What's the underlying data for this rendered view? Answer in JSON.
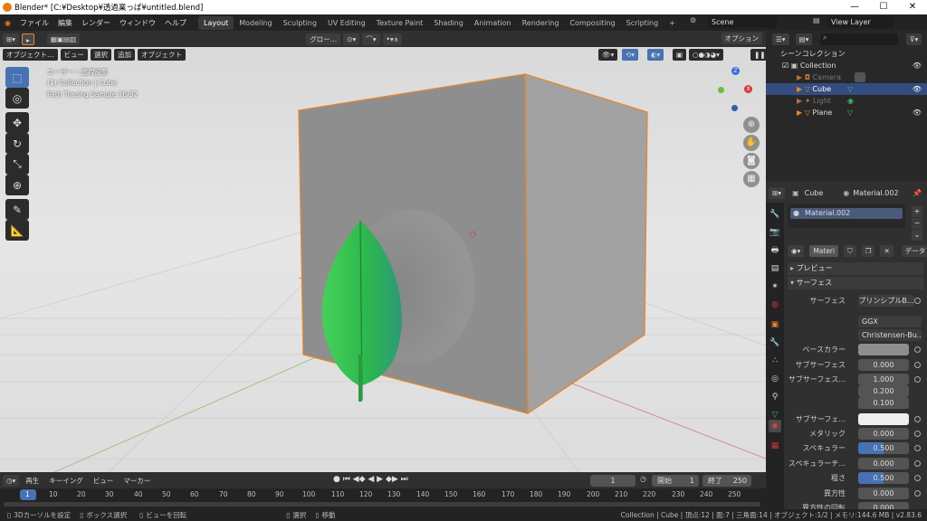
{
  "window": {
    "title": "Blender* [C:¥Desktop¥透過業っぱ¥untitled.blend]",
    "controls": [
      "—",
      "☐",
      "✕"
    ]
  },
  "menu": {
    "items": [
      "ファイル",
      "編集",
      "レンダー",
      "ウィンドウ",
      "ヘルプ"
    ],
    "workspaces": [
      "Layout",
      "Modeling",
      "Sculpting",
      "UV Editing",
      "Texture Paint",
      "Shading",
      "Animation",
      "Rendering",
      "Compositing",
      "Scripting"
    ],
    "add_tab": "+",
    "scene": "Scene",
    "view_layer": "View Layer"
  },
  "viewport_header": {
    "transform": "グロー…",
    "options": "オプション"
  },
  "viewport_subheader": {
    "mode": "オブジェクト…",
    "items": [
      "ビュー",
      "選択",
      "追加",
      "オブジェクト"
    ]
  },
  "viewport_overlay": {
    "view_name": "ユーザー・透視投影",
    "collection": "(1) Collection | Cube",
    "render_info": "Path Tracing Sample 16/32"
  },
  "outliner": {
    "search_placeholder": "",
    "root": "シーンコレクション",
    "collection": "Collection",
    "objects": [
      "Camera",
      "Cube",
      "Light",
      "Plane"
    ]
  },
  "properties": {
    "object": "Cube",
    "material": "Material.002",
    "slot": "Material.002",
    "mat_field": "Materi",
    "data_label": "データ",
    "sections": {
      "preview": "プレビュー",
      "surface": "サーフェス"
    },
    "rows": [
      {
        "label": "サーフェス",
        "value": "プリンシプルB..."
      },
      {
        "label": "",
        "value": "GGX"
      },
      {
        "label": "",
        "value": "Christensen-Bu..."
      },
      {
        "label": "ベースカラー",
        "value": ""
      },
      {
        "label": "サブサーフェス",
        "value": "0.000"
      },
      {
        "label": "サブサーフェス...",
        "value": "1.000"
      },
      {
        "label": "",
        "value": "0.200"
      },
      {
        "label": "",
        "value": "0.100"
      },
      {
        "label": "サブサーフェ...",
        "value": ""
      },
      {
        "label": "メタリック",
        "value": "0.000"
      },
      {
        "label": "スペキュラー",
        "value": "0.500"
      },
      {
        "label": "スペキュラーチ...",
        "value": "0.000"
      },
      {
        "label": "粗さ",
        "value": "0.500"
      },
      {
        "label": "異方性",
        "value": "0.000"
      },
      {
        "label": "異方性の回転",
        "value": "0.000"
      }
    ]
  },
  "timeline": {
    "menus": [
      "再生",
      "キーイング",
      "ビュー",
      "マーカー"
    ],
    "current_frame": "1",
    "start_label": "開始",
    "start": "1",
    "end_label": "終了",
    "end": "250",
    "frames": [
      "1",
      "10",
      "20",
      "30",
      "40",
      "50",
      "60",
      "70",
      "80",
      "90",
      "100",
      "110",
      "120",
      "130",
      "140",
      "150",
      "160",
      "170",
      "180",
      "190",
      "200",
      "210",
      "220",
      "230",
      "240",
      "250"
    ]
  },
  "statusbar": {
    "hints": [
      "3Dカーソルを設定",
      "ボックス選択",
      "ビューを回転",
      "選択",
      "移動"
    ],
    "stats": "Collection | Cube | 頂点:12 | 面:7 | 三角面:14 | オブジェクト:1/2 | メモリ:144.6 MB | v2.83.6"
  },
  "colors": {
    "accent": "#4772b3",
    "selection_outline": "#e8852a",
    "leaf": "#2fb84a"
  }
}
